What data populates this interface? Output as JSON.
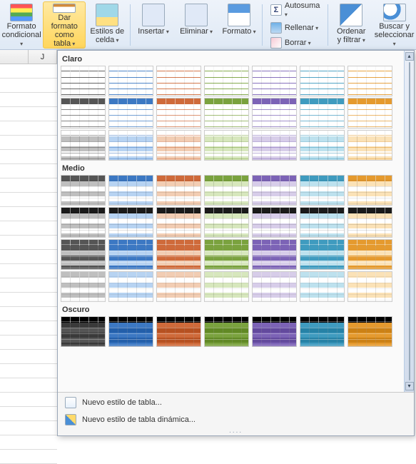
{
  "ribbon": {
    "conditional_format": "Formato\ncondicional",
    "format_as_table": "Dar formato\ncomo tabla",
    "cell_styles": "Estilos de\ncelda",
    "insert": "Insertar",
    "delete": "Eliminar",
    "format": "Formato",
    "autosum": "Autosuma",
    "fill": "Rellenar",
    "clear": "Borrar",
    "sort_filter": "Ordenar\ny filtrar",
    "find_select": "Buscar y\nseleccionar"
  },
  "sheet": {
    "col_letter": "J"
  },
  "gallery": {
    "sections": {
      "light": "Claro",
      "medium": "Medio",
      "dark": "Oscuro"
    },
    "palette": [
      "#555555",
      "#3c78c3",
      "#cf6a3a",
      "#7aa23e",
      "#7c63b6",
      "#3f9bbf",
      "#e59a2e"
    ],
    "light_palette": [
      "#bfbfbf",
      "#b7d3f2",
      "#f2cdb3",
      "#d7e7bd",
      "#d7cde9",
      "#bde1ee",
      "#fbe2b7"
    ],
    "footer": {
      "new_table_style": "Nuevo estilo de tabla...",
      "new_pivot_style": "Nuevo estilo de tabla dinámica..."
    }
  }
}
